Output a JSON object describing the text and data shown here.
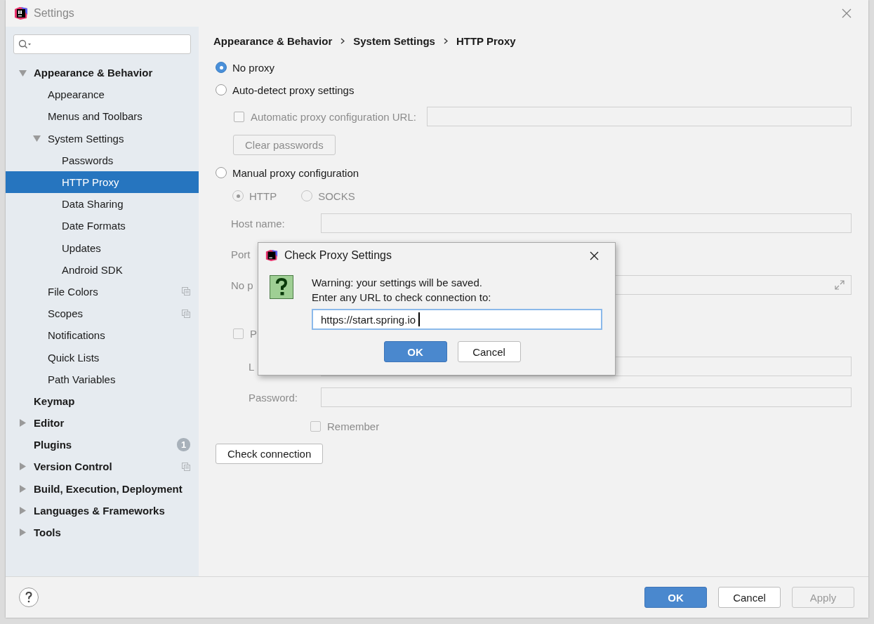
{
  "window": {
    "title": "Settings"
  },
  "sidebar": {
    "items": [
      {
        "label": "Appearance & Behavior",
        "expanded": true,
        "selected": false,
        "project_icon": false,
        "children": [
          {
            "label": "Appearance",
            "selected": false,
            "project_icon": false
          },
          {
            "label": "Menus and Toolbars",
            "selected": false,
            "project_icon": false
          },
          {
            "label": "System Settings",
            "expanded": true,
            "selected": false,
            "project_icon": false,
            "children": [
              {
                "label": "Passwords",
                "selected": false,
                "project_icon": false
              },
              {
                "label": "HTTP Proxy",
                "selected": true,
                "project_icon": false
              },
              {
                "label": "Data Sharing",
                "selected": false,
                "project_icon": false
              },
              {
                "label": "Date Formats",
                "selected": false,
                "project_icon": false
              },
              {
                "label": "Updates",
                "selected": false,
                "project_icon": false
              },
              {
                "label": "Android SDK",
                "selected": false,
                "project_icon": false
              }
            ]
          },
          {
            "label": "File Colors",
            "selected": false,
            "project_icon": true
          },
          {
            "label": "Scopes",
            "selected": false,
            "project_icon": true
          },
          {
            "label": "Notifications",
            "selected": false,
            "project_icon": false
          },
          {
            "label": "Quick Lists",
            "selected": false,
            "project_icon": false
          },
          {
            "label": "Path Variables",
            "selected": false,
            "project_icon": false
          }
        ]
      },
      {
        "label": "Keymap",
        "selected": false,
        "project_icon": false
      },
      {
        "label": "Editor",
        "expanded": false,
        "selected": false,
        "project_icon": false
      },
      {
        "label": "Plugins",
        "selected": false,
        "project_icon": false,
        "badge": "1"
      },
      {
        "label": "Version Control",
        "expanded": false,
        "selected": false,
        "project_icon": true
      },
      {
        "label": "Build, Execution, Deployment",
        "expanded": false,
        "selected": false,
        "project_icon": false
      },
      {
        "label": "Languages & Frameworks",
        "expanded": false,
        "selected": false,
        "project_icon": false
      },
      {
        "label": "Tools",
        "expanded": false,
        "selected": false,
        "project_icon": false
      }
    ]
  },
  "breadcrumb": [
    "Appearance & Behavior",
    "System Settings",
    "HTTP Proxy"
  ],
  "proxy_modes": [
    {
      "label": "No proxy",
      "selected": true
    },
    {
      "label": "Auto-detect proxy settings",
      "selected": false
    },
    {
      "label": "Manual proxy configuration",
      "selected": false
    }
  ],
  "auto": {
    "disabled": true,
    "pac_checkbox": {
      "label": "Automatic proxy configuration URL:",
      "checked": false
    },
    "clear_button": "Clear passwords"
  },
  "manual": {
    "disabled": true,
    "protocols": [
      {
        "label": "HTTP",
        "selected": true
      },
      {
        "label": "SOCKS",
        "selected": false
      }
    ],
    "fields": [
      {
        "label": "Host name:",
        "kind": "field"
      },
      {
        "label": "Port",
        "kind": "label"
      },
      {
        "label": "No p",
        "kind": "expand"
      }
    ],
    "auth_checkbox": {
      "label": "P",
      "checked": false
    },
    "auth_fields": [
      {
        "label": "L"
      },
      {
        "label": "Password:"
      }
    ],
    "remember": {
      "label": "Remember",
      "checked": false
    }
  },
  "check_button": "Check connection",
  "dialog": {
    "title": "Check Proxy Settings",
    "message": [
      "Warning: your settings will be saved.",
      "Enter any URL to check connection to:"
    ],
    "url": "https://start.spring.io",
    "ok": "OK",
    "cancel": "Cancel"
  },
  "footer": {
    "ok": "OK",
    "cancel": "Cancel",
    "apply": {
      "label": "Apply",
      "disabled": true
    }
  }
}
